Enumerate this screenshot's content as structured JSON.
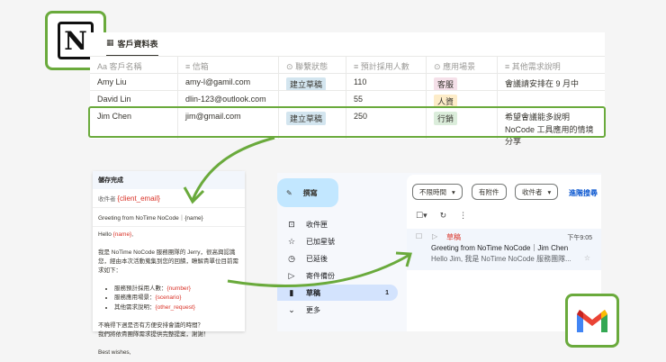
{
  "notion": {
    "logo": "N",
    "tab_label": "客戶資料表",
    "columns": [
      "客戶名稱",
      "信箱",
      "聯繫狀態",
      "預計採用人數",
      "應用場景",
      "其他需求說明"
    ],
    "column_icons": [
      "Aa",
      "≡",
      "⊙",
      "≡",
      "⊙",
      "≡"
    ],
    "rows": [
      {
        "name": "Amy Liu",
        "email": "amy-l@gamil.com",
        "status": "建立草稿",
        "count": "110",
        "scenario": "客服",
        "note": "會議請安排在 9 月中"
      },
      {
        "name": "David Lin",
        "email": "dlin-123@outlook.com",
        "status": "",
        "count": "55",
        "scenario": "人資",
        "note": ""
      },
      {
        "name": "Jim Chen",
        "email": "jim@gmail.com",
        "status": "建立草稿",
        "count": "250",
        "scenario": "行銷",
        "note": "希望會議能多說明 NoCode 工具應用的情境分享"
      }
    ]
  },
  "draft": {
    "header": "儲存完成",
    "to_label": "收件者",
    "to_value": "{client_email}",
    "subject": "Greeting from NoTime NoCode｜{name}",
    "hello": "Hello ",
    "hello_var": "{name}",
    "hello_end": ",",
    "p1": "我是 NoTime NoCode 服務團隊的 Jerry，很高興認識您，經由本次活動蒐集到您的回饋，瞭解貴單位目前需求如下：",
    "bullets": [
      {
        "label": "服務預計採用人數：",
        "var": "{number}"
      },
      {
        "label": "服務應用場景：",
        "var": "{scenario}"
      },
      {
        "label": "其他需求說明：",
        "var": "{other_request}"
      }
    ],
    "p2": "不曉得下週是否有方便安排會議的時間？",
    "p3": "我們將依貴團隊需求提供完整提案，謝謝！",
    "sign": "Best wishes,"
  },
  "gmail": {
    "compose": "撰寫",
    "nav": [
      {
        "icon": "inbox-icon",
        "glyph": "⊡",
        "label": "收件匣"
      },
      {
        "icon": "star-icon",
        "glyph": "☆",
        "label": "已加星號"
      },
      {
        "icon": "clock-icon",
        "glyph": "◷",
        "label": "已延後"
      },
      {
        "icon": "send-icon",
        "glyph": "▷",
        "label": "寄件備份"
      },
      {
        "icon": "draft-icon",
        "glyph": "▮",
        "label": "草稿",
        "count": "1"
      },
      {
        "icon": "chevron-down-icon",
        "glyph": "⌄",
        "label": "更多"
      }
    ],
    "filters": [
      "不限時間",
      "有附件",
      "收件者"
    ],
    "advanced": "進階搜尋",
    "mail": {
      "label": "草稿",
      "time": "下午9:05",
      "subject": "Greeting from NoTime NoCode｜Jim Chen",
      "snippet": "Hello Jim, 我是 NoTime NoCode 服務團隊..."
    }
  },
  "colors": {
    "accent": "#6aaa3c",
    "red": "#d93025",
    "link": "#0b57d0"
  }
}
